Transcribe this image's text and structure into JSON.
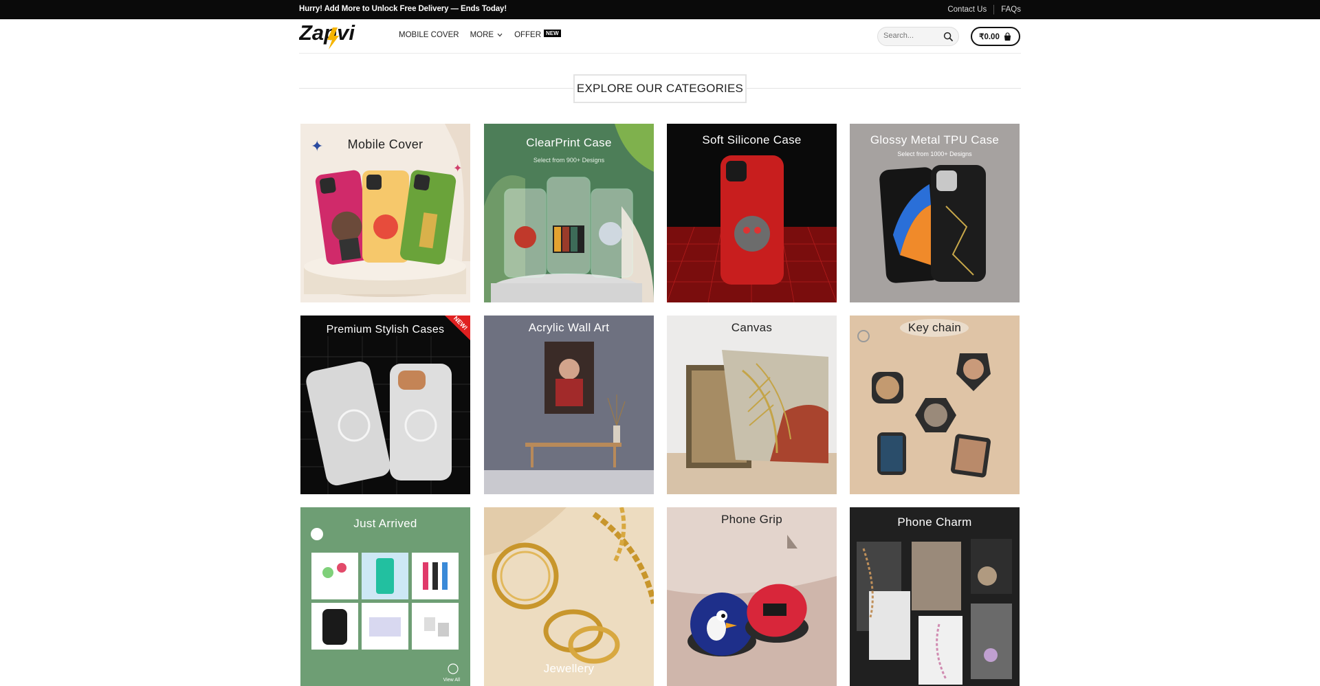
{
  "topbar": {
    "promo": "Hurry! Add More to Unlock Free Delivery — Ends Today!",
    "contact": "Contact Us",
    "faqs": "FAQs"
  },
  "header": {
    "logo_text": "Zapvi",
    "nav": {
      "mobile_cover": "MOBILE COVER",
      "more": "MORE",
      "offer": "OFFER",
      "offer_badge": "NEW"
    },
    "search_placeholder": "Search...",
    "cart_total": "₹0.00"
  },
  "section": {
    "title": "EXPLORE OUR CATEGORIES"
  },
  "categories": [
    {
      "title": "Mobile Cover",
      "subtitle": ""
    },
    {
      "title": "ClearPrint Case",
      "subtitle": "Select from 900+ Designs"
    },
    {
      "title": "Soft Silicone Case",
      "subtitle": ""
    },
    {
      "title": "Glossy Metal TPU Case",
      "subtitle": "Select from 1000+ Designs"
    },
    {
      "title": "Premium Stylish Cases",
      "subtitle": "",
      "badge": "NEW!"
    },
    {
      "title": "Acrylic Wall Art",
      "subtitle": ""
    },
    {
      "title": "Canvas",
      "subtitle": ""
    },
    {
      "title": "Key chain",
      "subtitle": ""
    },
    {
      "title": "Just Arrived",
      "subtitle": "",
      "link": "View All"
    },
    {
      "title": "Jewellery",
      "subtitle": ""
    },
    {
      "title": "Phone Grip",
      "subtitle": ""
    },
    {
      "title": "Phone Charm",
      "subtitle": ""
    }
  ],
  "colors": {
    "topbar_bg": "#0a0a0a",
    "accent": "#f5b400",
    "border": "#e3e3e3"
  }
}
